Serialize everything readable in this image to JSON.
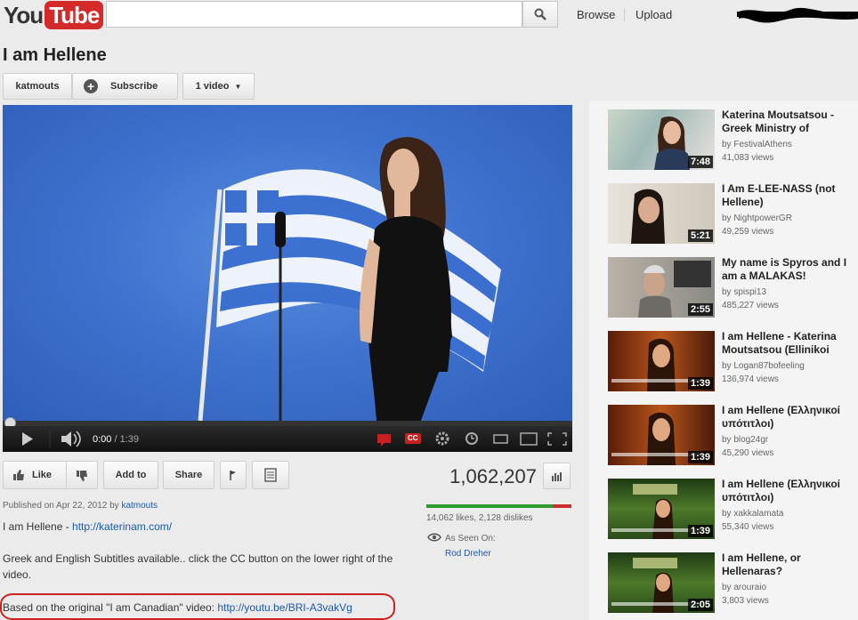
{
  "header": {
    "logo_you": "You",
    "logo_tube": "Tube",
    "search_placeholder": "",
    "browse": "Browse",
    "upload": "Upload"
  },
  "video": {
    "title": "I am Hellene",
    "channel": "katmouts",
    "subscribe": "Subscribe",
    "videos_count": "1 video",
    "time_current": "0:00",
    "time_total": "/ 1:39",
    "progress": 0,
    "cc_label": "CC"
  },
  "actions": {
    "like": "Like",
    "add_to": "Add to",
    "share": "Share",
    "views": "1,062,207",
    "likes_text": "14,062 likes, 2,128 dislikes",
    "like_ratio": 0.869,
    "as_seen_on": "As Seen On:",
    "as_seen_link": "Rod Dreher"
  },
  "description": {
    "published_prefix": "Published on Apr 22, 2012 by",
    "published_by": "katmouts",
    "line1_text": "I am Hellene - ",
    "line1_link": "http://katerinam.com/",
    "line2": "Greek and English Subtitles available.. click the CC button on the lower right of the video.",
    "line3_text": "Based on the original \"I am Canadian\" video: ",
    "line3_link": "http://youtu.be/BRI-A3vakVg"
  },
  "related": [
    {
      "title": "Katerina Moutsatsou - Greek Ministry of",
      "by": "by FestivalAthens",
      "views": "41,083 views",
      "duration": "7:48"
    },
    {
      "title": "I Am E-LEE-NASS (not Hellene)",
      "by": "by NightpowerGR",
      "views": "49,259 views",
      "duration": "5:21"
    },
    {
      "title": "My name is Spyros and I am a MALAKAS!",
      "by": "by spispi13",
      "views": "485,227 views",
      "duration": "2:55"
    },
    {
      "title": "I am Hellene - Katerina Moutsatsou (Ellinikoi",
      "by": "by Logan87bofeeling",
      "views": "136,974 views",
      "duration": "1:39"
    },
    {
      "title": "I am Hellene (Ελληνικοί υπότιτλοι)",
      "by": "by blog24gr",
      "views": "45,290 views",
      "duration": "1:39"
    },
    {
      "title": "I am Hellene (Ελληνικοί υπότιτλοι)",
      "by": "by xakkalamata",
      "views": "55,340 views",
      "duration": "1:39"
    },
    {
      "title": "I am Hellene, or Hellenaras?",
      "by": "by arouraio",
      "views": "3,803 views",
      "duration": "2:05"
    }
  ]
}
